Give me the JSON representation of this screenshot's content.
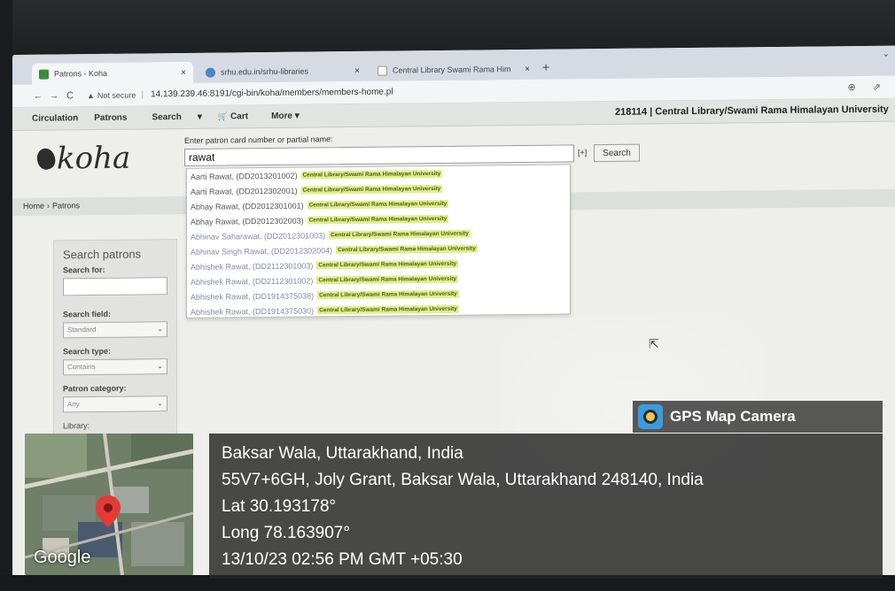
{
  "browser": {
    "tabs": [
      {
        "title": "Patrons - Koha",
        "close": "×",
        "favicon_color": "#3c8b3c"
      },
      {
        "title": "srhu.edu.in/srhu-libraries",
        "close": "×",
        "favicon_color": "#4a86c9"
      },
      {
        "title": "Central Library Swami Rama Him",
        "close": "×",
        "favicon_color": "#d9d9d9"
      }
    ],
    "new_tab": "+",
    "nav": {
      "back": "←",
      "forward": "→",
      "reload": "C"
    },
    "security_label": "Not secure",
    "url": "14.139.239.46:8191/cgi-bin/koha/members/members-home.pl",
    "icons_right": "⊕ ⇗"
  },
  "koha": {
    "nav": [
      "Circulation",
      "Patrons",
      "Search",
      "▾",
      "Cart",
      "More ▾"
    ],
    "branch_info": "218114 | Central Library/Swami Rama Himalayan University",
    "logo": "koha",
    "search_label": "Enter patron card number or partial name:",
    "search_value": "rawat",
    "expand_link": "[+]",
    "search_button": "Search",
    "breadcrumb": [
      "Home",
      "›",
      "Patrons"
    ],
    "suggestions": [
      {
        "name": "Aarti Rawat, (DD2013201002)",
        "branch": "Central Library/Swami Rama Himalayan University"
      },
      {
        "name": "Aarti Rawat, (DD2012302001)",
        "branch": "Central Library/Swami Rama Himalayan University"
      },
      {
        "name": "Abhay Rawat, (DD2012301001)",
        "branch": "Central Library/Swami Rama Himalayan University"
      },
      {
        "name": "Abhay Rawat, (DD2012302003)",
        "branch": "Central Library/Swami Rama Himalayan University"
      },
      {
        "name": "Abhinav Saharawat, (DD2012301003)",
        "branch": "Central Library/Swami Rama Himalayan University"
      },
      {
        "name": "Abhinav Singh Rawat, (DD2012302004)",
        "branch": "Central Library/Swami Rama Himalayan University"
      },
      {
        "name": "Abhishek Rawat, (DD2112301003)",
        "branch": "Central Library/Swami Rama Himalayan University"
      },
      {
        "name": "Abhishek Rawat, (DD2112301002)",
        "branch": "Central Library/Swami Rama Himalayan University"
      },
      {
        "name": "Abhishek Rawat, (DD1914375038)",
        "branch": "Central Library/Swami Rama Himalayan University"
      },
      {
        "name": "Abhishek Rawat, (DD1914375030)",
        "branch": "Central Library/Swami Rama Himalayan University"
      }
    ],
    "sidebar": {
      "title": "Search patrons",
      "search_for_label": "Search for:",
      "search_field_label": "Search field:",
      "search_field_value": "Standard",
      "search_type_label": "Search type:",
      "search_type_value": "Contains",
      "category_label": "Patron category:",
      "category_value": "Any",
      "library_label": "Library:"
    }
  },
  "gps": {
    "app_name": "GPS Map Camera",
    "place": "Baksar Wala, Uttarakhand, India",
    "address": "55V7+6GH, Joly Grant, Baksar Wala, Uttarakhand 248140, India",
    "lat": "Lat 30.193178°",
    "long": "Long 78.163907°",
    "datetime": "13/10/23 02:56 PM GMT +05:30",
    "map_brand": "Google"
  }
}
